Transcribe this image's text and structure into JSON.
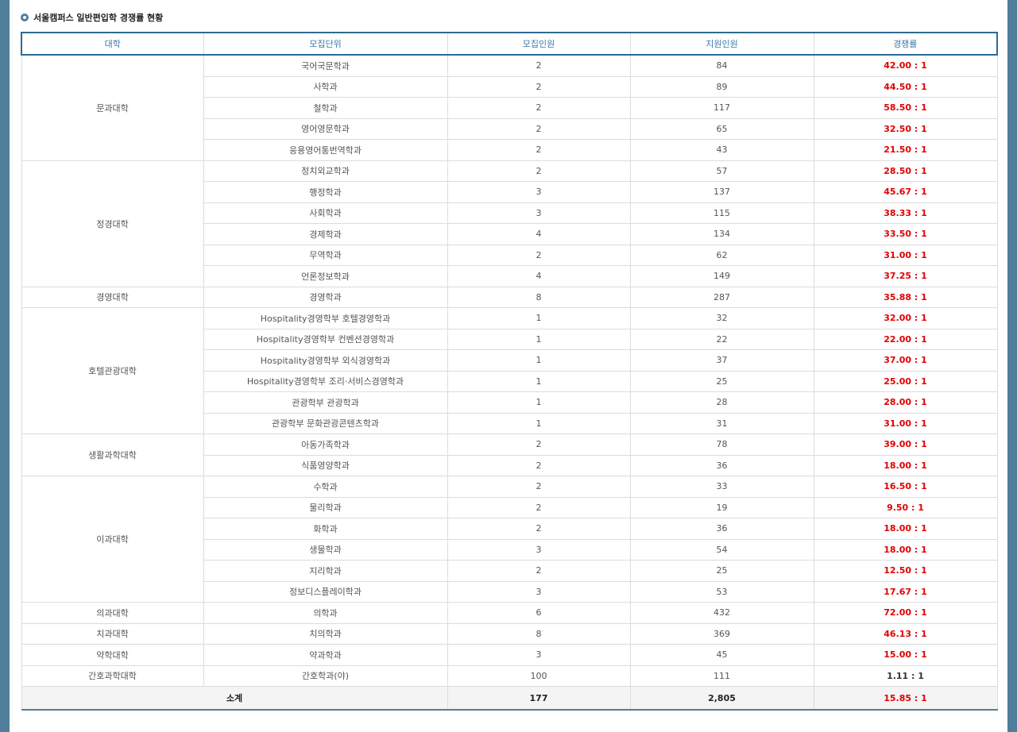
{
  "section_title": "서울캠퍼스 일반편입학 경쟁률 현황",
  "table": {
    "headers": [
      "대학",
      "모집단위",
      "모집인원",
      "지원인원",
      "경쟁률"
    ],
    "groups": [
      {
        "college": "문과대학",
        "rows": [
          [
            "국어국문학과",
            "2",
            "84",
            "42.00 : 1"
          ],
          [
            "사학과",
            "2",
            "89",
            "44.50 : 1"
          ],
          [
            "철학과",
            "2",
            "117",
            "58.50 : 1"
          ],
          [
            "영어영문학과",
            "2",
            "65",
            "32.50 : 1"
          ],
          [
            "응용영어통번역학과",
            "2",
            "43",
            "21.50 : 1"
          ]
        ]
      },
      {
        "college": "정경대학",
        "rows": [
          [
            "정치외교학과",
            "2",
            "57",
            "28.50 : 1"
          ],
          [
            "행정학과",
            "3",
            "137",
            "45.67 : 1"
          ],
          [
            "사회학과",
            "3",
            "115",
            "38.33 : 1"
          ],
          [
            "경제학과",
            "4",
            "134",
            "33.50 : 1"
          ],
          [
            "무역학과",
            "2",
            "62",
            "31.00 : 1"
          ],
          [
            "언론정보학과",
            "4",
            "149",
            "37.25 : 1"
          ]
        ]
      },
      {
        "college": "경영대학",
        "rows": [
          [
            "경영학과",
            "8",
            "287",
            "35.88 : 1"
          ]
        ]
      },
      {
        "college": "호텔관광대학",
        "rows": [
          [
            "Hospitality경영학부 호텔경영학과",
            "1",
            "32",
            "32.00 : 1"
          ],
          [
            "Hospitality경영학부 컨벤션경영학과",
            "1",
            "22",
            "22.00 : 1"
          ],
          [
            "Hospitality경영학부 외식경영학과",
            "1",
            "37",
            "37.00 : 1"
          ],
          [
            "Hospitality경영학부 조리·서비스경영학과",
            "1",
            "25",
            "25.00 : 1"
          ],
          [
            "관광학부 관광학과",
            "1",
            "28",
            "28.00 : 1"
          ],
          [
            "관광학부 문화관광콘텐츠학과",
            "1",
            "31",
            "31.00 : 1"
          ]
        ]
      },
      {
        "college": "생활과학대학",
        "rows": [
          [
            "아동가족학과",
            "2",
            "78",
            "39.00 : 1"
          ],
          [
            "식품영양학과",
            "2",
            "36",
            "18.00 : 1"
          ]
        ]
      },
      {
        "college": "이과대학",
        "rows": [
          [
            "수학과",
            "2",
            "33",
            "16.50 : 1"
          ],
          [
            "물리학과",
            "2",
            "19",
            "9.50 : 1"
          ],
          [
            "화학과",
            "2",
            "36",
            "18.00 : 1"
          ],
          [
            "생물학과",
            "3",
            "54",
            "18.00 : 1"
          ],
          [
            "지리학과",
            "2",
            "25",
            "12.50 : 1"
          ],
          [
            "정보디스플레이학과",
            "3",
            "53",
            "17.67 : 1"
          ]
        ]
      },
      {
        "college": "의과대학",
        "rows": [
          [
            "의학과",
            "6",
            "432",
            "72.00 : 1"
          ]
        ]
      },
      {
        "college": "치과대학",
        "rows": [
          [
            "치의학과",
            "8",
            "369",
            "46.13 : 1"
          ]
        ]
      },
      {
        "college": "약학대학",
        "rows": [
          [
            "약과학과",
            "3",
            "45",
            "15.00 : 1"
          ]
        ]
      },
      {
        "college": "간호과학대학",
        "rows": [
          [
            "간호학과(야)",
            "100",
            "111",
            "1.11 : 1"
          ]
        ],
        "plain_rate": true
      }
    ],
    "total": {
      "label": "소계",
      "quota": "177",
      "applicants": "2,805",
      "rate": "15.85 : 1"
    }
  },
  "colors": {
    "accent": "#4f7e9a",
    "header_text": "#3a78a8",
    "rate_red": "#e10000"
  }
}
